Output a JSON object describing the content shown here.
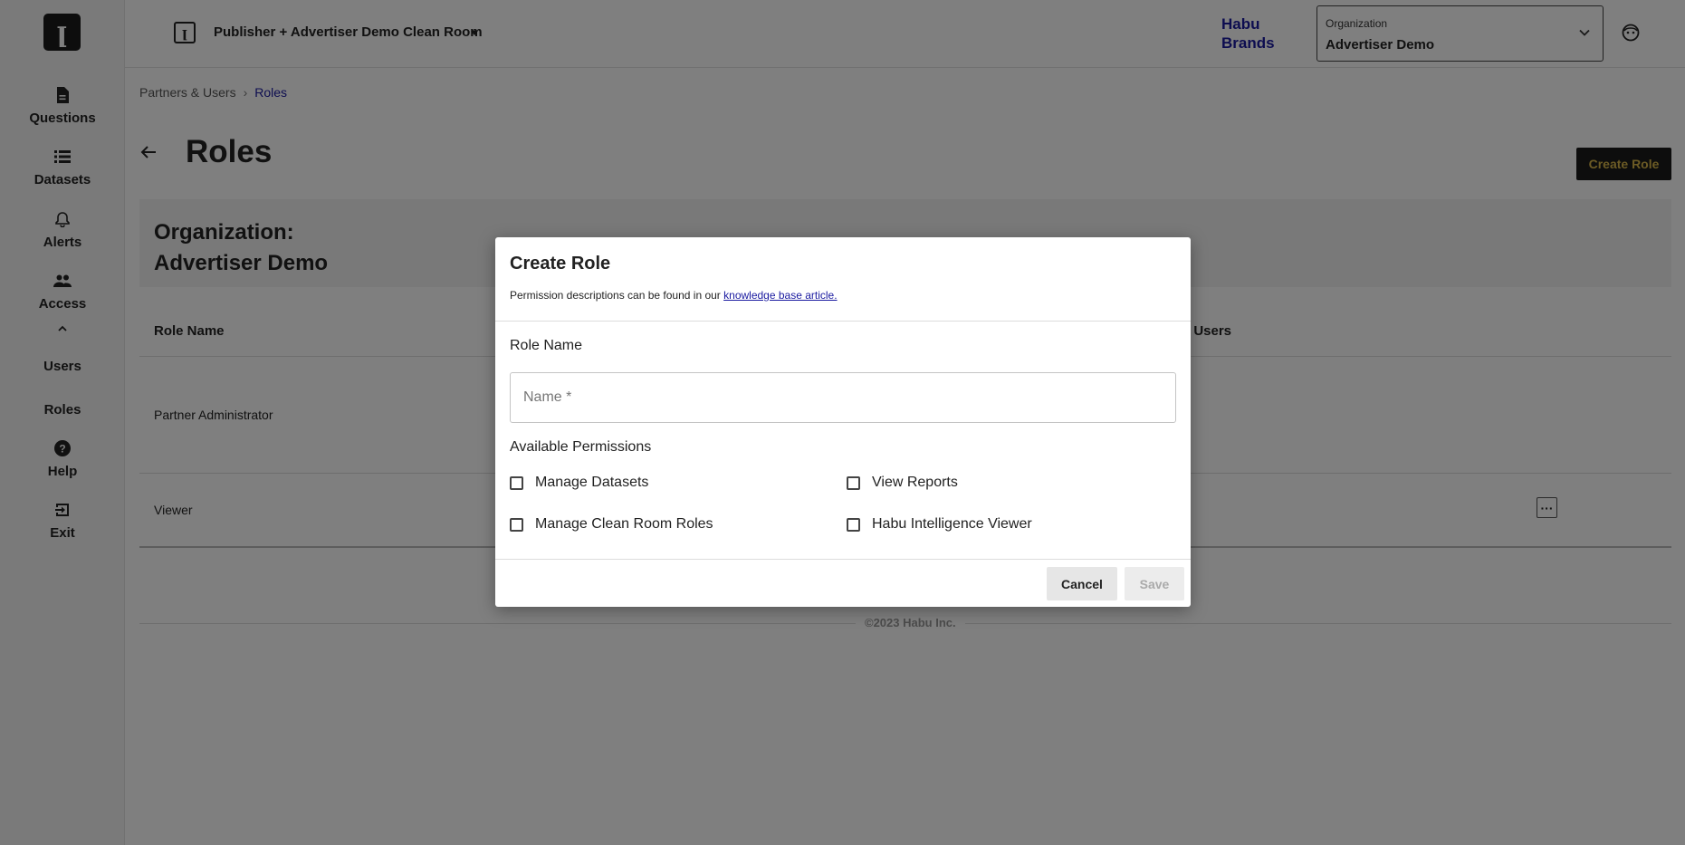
{
  "sidebar": {
    "logo": "logo",
    "items": [
      {
        "label": "Questions",
        "icon": "document-icon"
      },
      {
        "label": "Datasets",
        "icon": "list-icon"
      },
      {
        "label": "Alerts",
        "icon": "bell-icon"
      },
      {
        "label": "Access",
        "icon": "people-icon"
      },
      {
        "label": "Users"
      },
      {
        "label": "Roles"
      },
      {
        "label": "Help",
        "icon": "help-icon"
      },
      {
        "label": "Exit",
        "icon": "exit-icon"
      }
    ]
  },
  "header": {
    "clean_room_title": "Publisher + Advertiser Demo Clean Room",
    "brand": "Habu Brands",
    "org_select": {
      "label": "Organization",
      "value": "Advertiser Demo"
    }
  },
  "breadcrumb": {
    "parent": "Partners & Users",
    "separator": "›",
    "current": "Roles"
  },
  "page": {
    "title": "Roles",
    "create_role_label": "Create Role",
    "org_heading_line1": "Organization:",
    "org_heading_line2": "Advertiser Demo"
  },
  "table": {
    "headers": {
      "role_name": "Role Name",
      "users_partial": "n Users"
    },
    "rows": [
      {
        "role_name": "Partner Administrator"
      },
      {
        "role_name": "Viewer",
        "action": "···"
      }
    ]
  },
  "footer": {
    "text": "©2023 Habu Inc."
  },
  "modal": {
    "title": "Create Role",
    "description_prefix": "Permission descriptions can be found in our ",
    "description_link": "knowledge base article.",
    "role_name_label": "Role Name",
    "name_placeholder": "Name *",
    "available_permissions_label": "Available Permissions",
    "permissions": [
      "Manage Datasets",
      "View Reports",
      "Manage Clean Room Roles",
      "Habu Intelligence Viewer"
    ],
    "cancel_label": "Cancel",
    "save_label": "Save"
  },
  "colors": {
    "brand_blue": "#1a1aa0",
    "create_button_bg": "#1a1a1a",
    "create_button_text": "#d8b64a"
  }
}
